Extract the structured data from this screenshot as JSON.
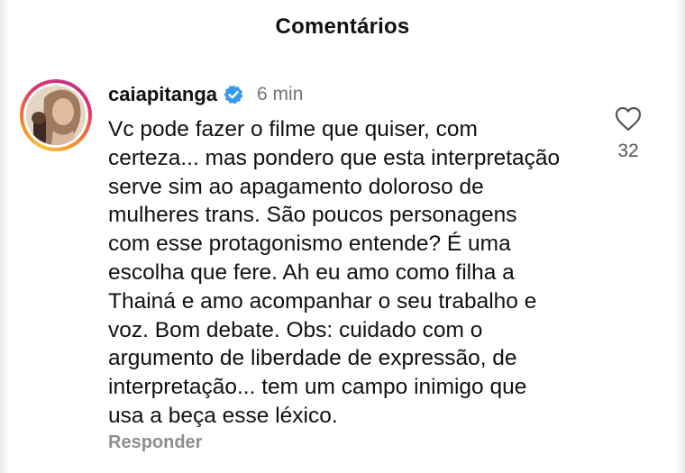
{
  "header": {
    "title": "Comentários"
  },
  "comment": {
    "username": "caiapitanga",
    "verified_icon": "verified-badge-icon",
    "time": "6 min",
    "text": "Vc pode fazer o filme que quiser, com\ncerteza... mas pondero que esta interpretação\nserve sim ao apagamento doloroso de\nmulheres trans. São poucos personagens\ncom esse protagonismo entende? É uma\nescolha que fere. Ah eu amo como filha a\nThainá e amo acompanhar o seu trabalho e\nvoz. Bom debate.  Obs: cuidado com o\nargumento de liberdade de expressão, de\ninterpretação... tem um campo inimigo que\nusa a beça esse léxico.",
    "like_icon": "heart-icon",
    "like_count": "32",
    "reply_label": "Responder"
  },
  "colors": {
    "verified": "#3897f0",
    "secondary_text": "#737373",
    "reply_text": "#8e8e8e"
  }
}
